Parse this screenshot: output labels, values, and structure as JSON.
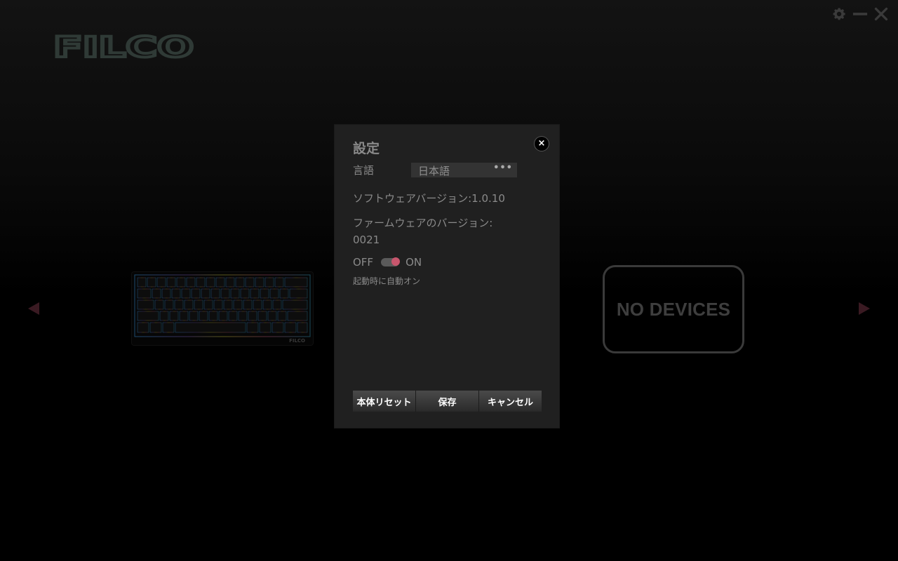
{
  "brand": {
    "logo_text": "FILCO"
  },
  "window_controls": {
    "settings_icon": "gear-icon",
    "minimize_icon": "minimize-icon",
    "close_icon": "close-icon"
  },
  "devices": {
    "keyboard_brand": "FILCO",
    "empty_slot_text": "NO DEVICES"
  },
  "settings_dialog": {
    "title": "設定",
    "language_label": "言語",
    "language_value": "日本語",
    "language_more": "•••",
    "software_version": "ソフトウェアバージョン:1.0.10",
    "firmware_version": "ファームウェアのバージョン:0021",
    "toggle_off_label": "OFF",
    "toggle_on_label": "ON",
    "toggle_state": "on",
    "auto_on_label": "起動時に自動オン",
    "close_glyph": "×",
    "buttons": {
      "reset": "本体リセット",
      "save": "保存",
      "cancel": "キャンセル"
    }
  },
  "colors": {
    "background": "#000000",
    "dialog": "#202020",
    "toggle_accent": "#c8566d",
    "logo": "#2f3a36",
    "arrow": "#3a1a22"
  }
}
